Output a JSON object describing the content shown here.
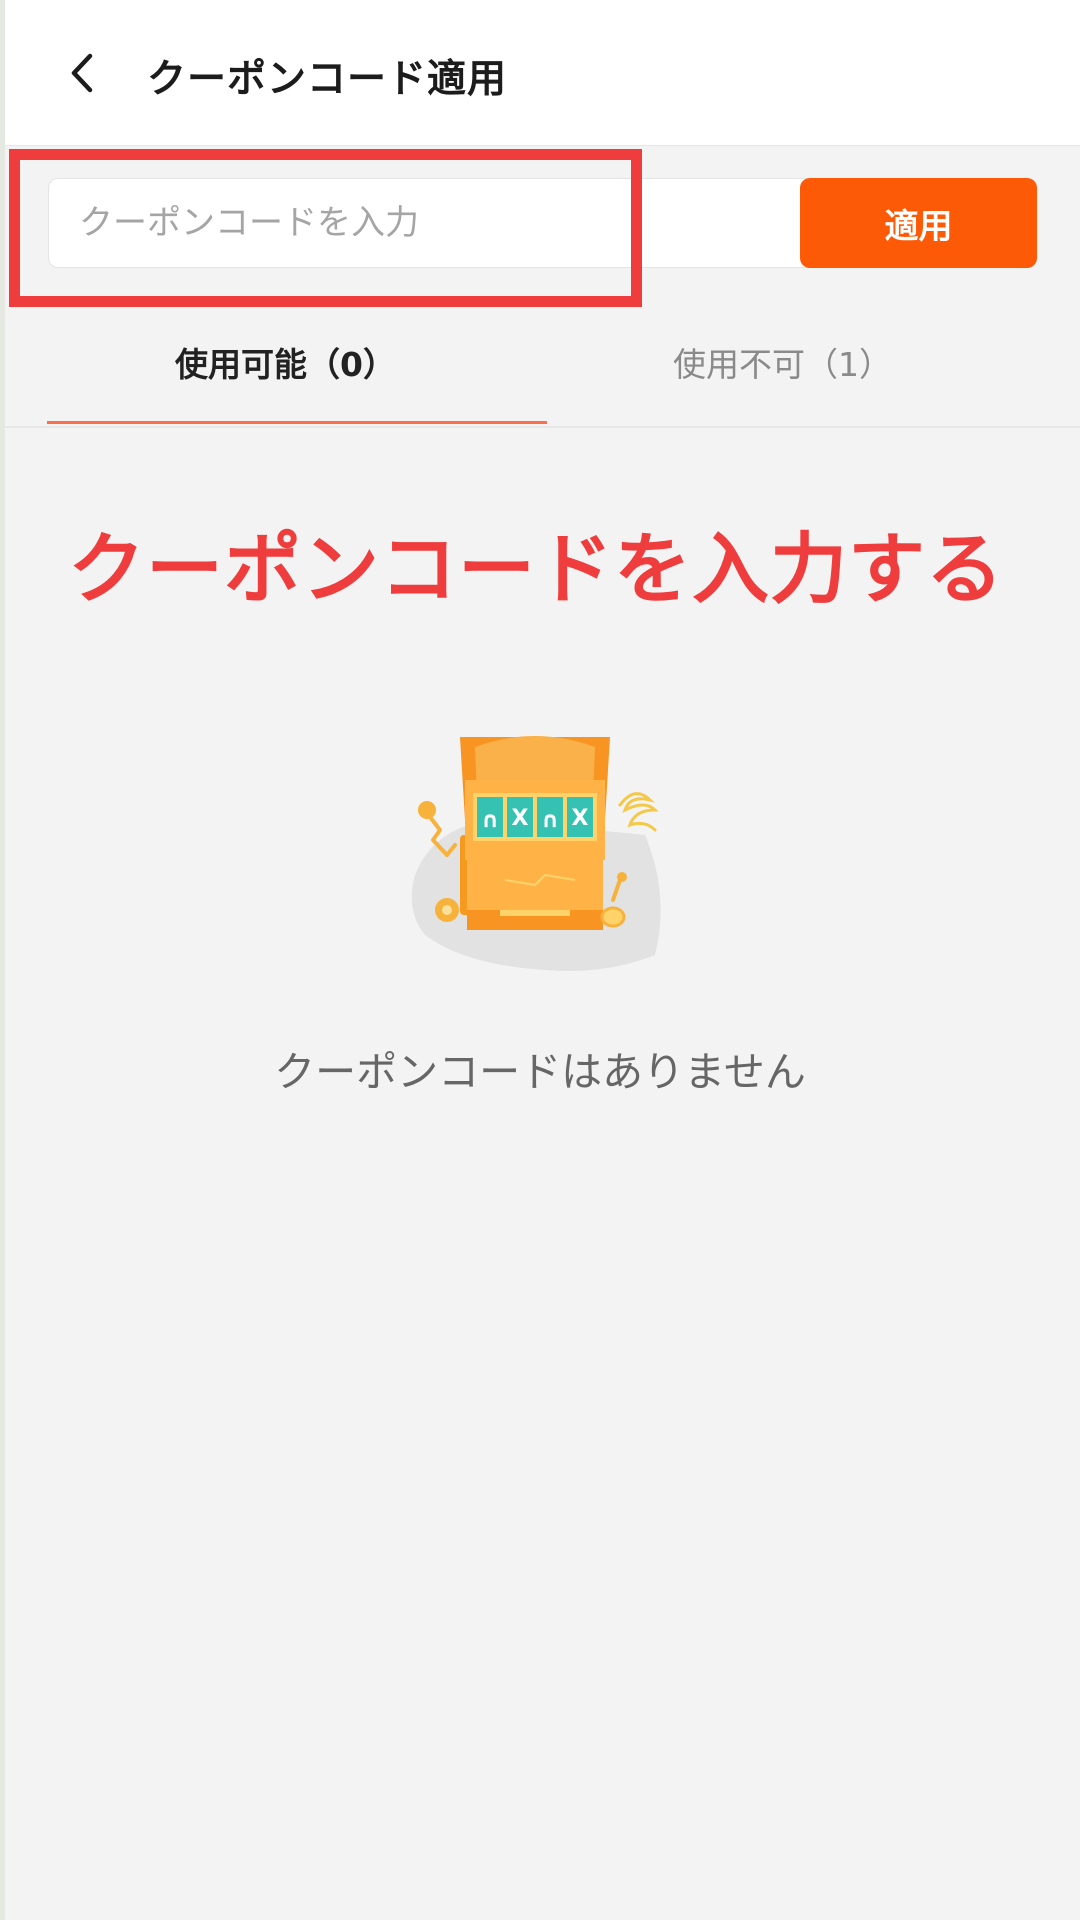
{
  "header": {
    "title": "クーポンコード適用",
    "back_icon": "chevron-left-icon"
  },
  "coupon": {
    "placeholder": "クーポンコードを入力",
    "value": "",
    "apply_label": "適用",
    "apply_color": "#fd5a07"
  },
  "tabs": [
    {
      "label": "使用可能（0）",
      "active": true
    },
    {
      "label": "使用不可（1）",
      "active": false
    }
  ],
  "annotation": {
    "text": "クーポンコードを入力する",
    "color": "#ef3c3c"
  },
  "empty_state": {
    "icon": "slot-machine-illustration",
    "message": "クーポンコードはありません"
  },
  "colors": {
    "accent": "#fd5a07",
    "tab_underline": "#fd6e4c",
    "background": "#f3f3f3"
  }
}
